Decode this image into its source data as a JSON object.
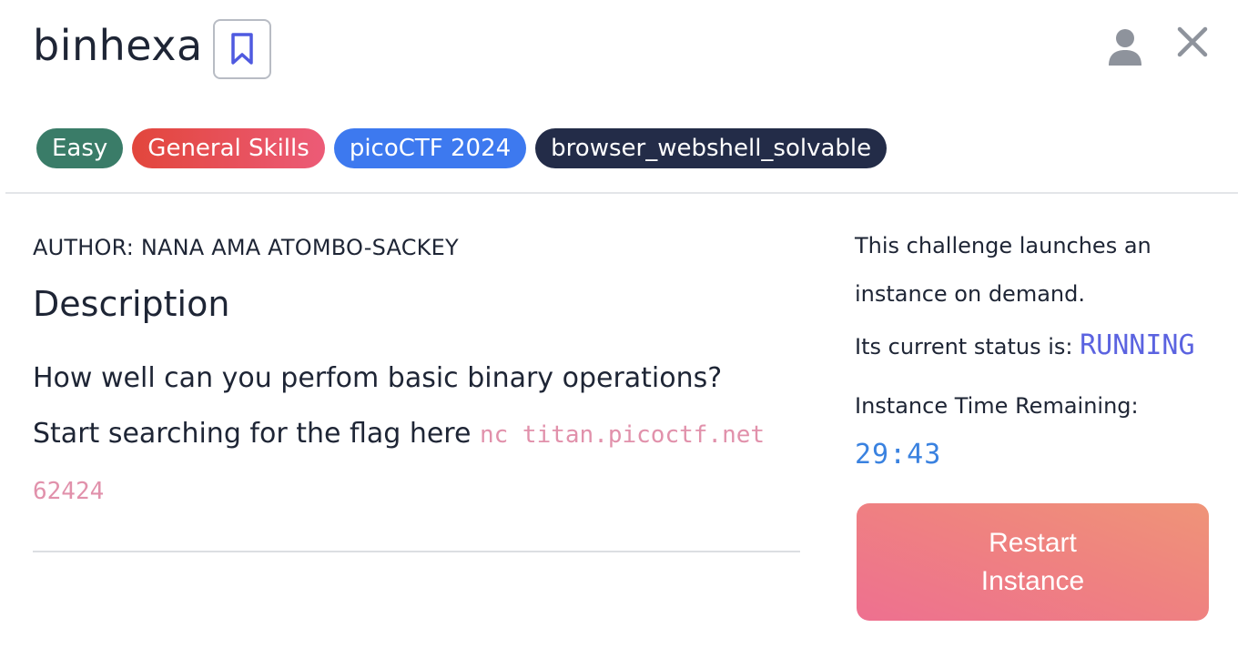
{
  "challenge": {
    "title": "binhexa",
    "tags": [
      {
        "label": "Easy",
        "color": "#3a7c68"
      },
      {
        "label": "General Skills",
        "color": "#e2463c"
      },
      {
        "label": "picoCTF 2024",
        "color": "#3d79ef"
      },
      {
        "label": "browser_webshell_solvable",
        "color": "#232c48"
      }
    ],
    "author": "AUTHOR: NANA AMA ATOMBO-SACKEY",
    "description_heading": "Description",
    "description_line1": "How well can you perfom basic binary operations?",
    "description_line2_text": "Start searching for the flag here ",
    "description_code_part1": "nc titan.picoctf.net",
    "description_code_part2": "62424"
  },
  "instance": {
    "launch_text_line1": "This challenge launches an",
    "launch_text_line2": "instance on demand.",
    "status_label": "Its current status is: ",
    "status_value": "RUNNING",
    "time_label": "Instance Time Remaining:",
    "time_value": "29:43",
    "restart_label": "Restart Instance"
  },
  "icons": {
    "bookmark": "bookmark-icon",
    "user": "user-icon",
    "close": "close-icon"
  },
  "colors": {
    "accent": "#5b63e0",
    "timer": "#3a82e0",
    "code": "#e191ab"
  }
}
